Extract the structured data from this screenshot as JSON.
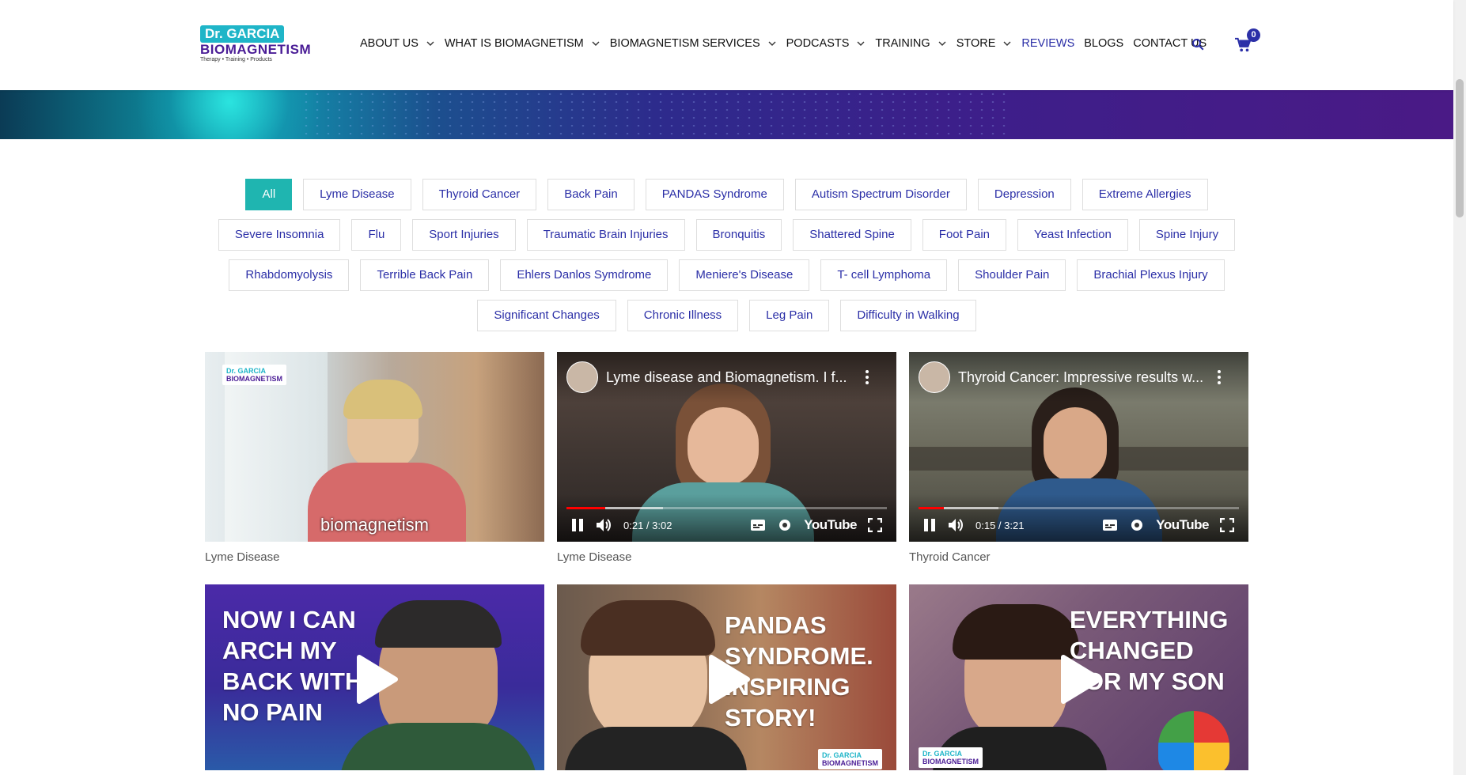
{
  "header": {
    "logo": {
      "line1": "Dr. GARCIA",
      "line2": "BIOMAGNETISM",
      "line3": "Therapy • Training • Products"
    },
    "nav": [
      {
        "label": "ABOUT US",
        "dropdown": true
      },
      {
        "label": "WHAT IS BIOMAGNETISM",
        "dropdown": true
      },
      {
        "label": "BIOMAGNETISM SERVICES",
        "dropdown": true
      },
      {
        "label": "PODCASTS",
        "dropdown": true
      },
      {
        "label": "TRAINING",
        "dropdown": true
      },
      {
        "label": "STORE",
        "dropdown": true
      },
      {
        "label": "REVIEWS",
        "dropdown": false,
        "active": true
      },
      {
        "label": "BLOGS",
        "dropdown": false
      },
      {
        "label": "CONTACT US",
        "dropdown": false
      }
    ],
    "cart_count": "0",
    "icons": {
      "search": "search-icon",
      "cart": "cart-icon"
    }
  },
  "filters": [
    [
      "All",
      "Lyme Disease",
      "Thyroid Cancer",
      "Back Pain",
      "PANDAS Syndrome",
      "Autism Spectrum Disorder",
      "Depression",
      "Extreme Allergies"
    ],
    [
      "Severe Insomnia",
      "Flu",
      "Sport Injuries",
      "Traumatic Brain Injuries",
      "Bronquitis",
      "Shattered Spine",
      "Foot Pain",
      "Yeast Infection",
      "Spine Injury"
    ],
    [
      "Rhabdomyolysis",
      "Terrible Back Pain",
      "Ehlers Danlos Symdrome",
      "Meniere's Disease",
      "T- cell Lymphoma",
      "Shoulder Pain",
      "Brachial Plexus Injury"
    ],
    [
      "Significant Changes",
      "Chronic Illness",
      "Leg Pain",
      "Difficulty in Walking"
    ]
  ],
  "active_filter": "All",
  "videos": [
    {
      "caption": "Lyme Disease",
      "subtitle": "biomagnetism",
      "logo1": "Dr. GARCIA",
      "logo2": "BIOMAGNETISM"
    },
    {
      "caption": "Lyme Disease",
      "title": "Lyme disease and Biomagnetism. I f...",
      "time": "0:21 / 3:02",
      "youtube": "YouTube",
      "progress": 0.12
    },
    {
      "caption": "Thyroid Cancer",
      "title": "Thyroid Cancer: Impressive results w...",
      "time": "0:15 / 3:21",
      "youtube": "YouTube",
      "progress": 0.08
    },
    {
      "overlay": [
        "NOW I CAN",
        "ARCH MY",
        "BACK WITH",
        "NO PAIN"
      ]
    },
    {
      "overlay": [
        "PANDAS",
        "SYNDROME.",
        "INSPIRING",
        "STORY!"
      ],
      "logo1": "Dr. GARCIA",
      "logo2": "BIOMAGNETISM"
    },
    {
      "overlay": [
        "EVERYTHING",
        "CHANGED",
        "FOR MY SON"
      ],
      "logo1": "Dr. GARCIA",
      "logo2": "BIOMAGNETISM"
    }
  ],
  "colors": {
    "accent": "#2b2fa7",
    "teal": "#1fb5b0",
    "purple": "#4a1d96"
  }
}
